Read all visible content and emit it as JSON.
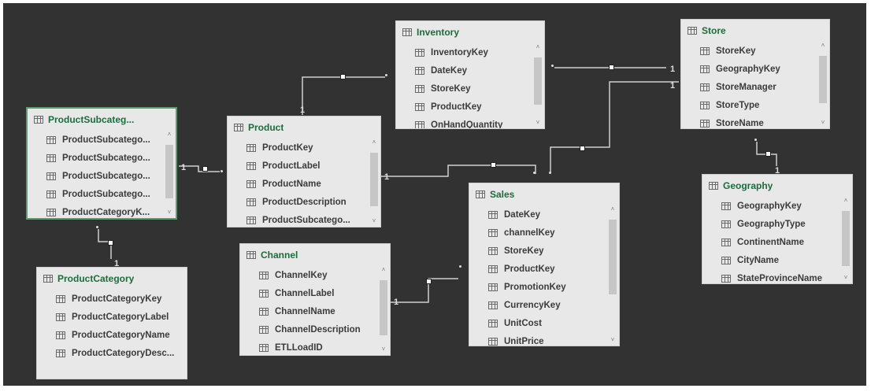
{
  "model": {
    "colors": {
      "canvas": "#323232",
      "table_bg": "#e8e8e8",
      "title": "#1d6c3c",
      "selected_border": "#5f9a72",
      "line": "#cfcfcf"
    },
    "icons": {
      "table": "table-grid-icon",
      "column": "column-icon",
      "scroll_up": "scroll-up-icon",
      "scroll_down": "scroll-down-icon"
    },
    "tables": [
      {
        "title": "ProductSubcateg...",
        "selected": true,
        "scroll": 0.0,
        "columns": [
          "ProductSubcatego...",
          "ProductSubcatego...",
          "ProductSubcatego...",
          "ProductSubcatego...",
          "ProductCategoryK..."
        ]
      },
      {
        "title": "ProductCategory",
        "selected": false,
        "columns": [
          "ProductCategoryKey",
          "ProductCategoryLabel",
          "ProductCategoryName",
          "ProductCategoryDesc..."
        ]
      },
      {
        "title": "Product",
        "selected": false,
        "scroll": 0.0,
        "columns": [
          "ProductKey",
          "ProductLabel",
          "ProductName",
          "ProductDescription",
          "ProductSubcatego..."
        ]
      },
      {
        "title": "Inventory",
        "selected": false,
        "scroll": 0.0,
        "columns": [
          "InventoryKey",
          "DateKey",
          "StoreKey",
          "ProductKey",
          "OnHandQuantity"
        ]
      },
      {
        "title": "Channel",
        "selected": false,
        "scroll": 0.0,
        "columns": [
          "ChannelKey",
          "ChannelLabel",
          "ChannelName",
          "ChannelDescription",
          "ETLLoadID"
        ]
      },
      {
        "title": "Sales",
        "selected": false,
        "scroll": 0.0,
        "columns": [
          "DateKey",
          "channelKey",
          "StoreKey",
          "ProductKey",
          "PromotionKey",
          "CurrencyKey",
          "UnitCost",
          "UnitPrice"
        ]
      },
      {
        "title": "Store",
        "selected": false,
        "scroll": 0.0,
        "columns": [
          "StoreKey",
          "GeographyKey",
          "StoreManager",
          "StoreType",
          "StoreName"
        ]
      },
      {
        "title": "Geography",
        "selected": false,
        "scroll": 0.0,
        "columns": [
          "GeographyKey",
          "GeographyType",
          "ContinentName",
          "CityName",
          "StateProvinceName"
        ]
      }
    ],
    "relationships": [
      {
        "from": "ProductSubcategory",
        "to": "Product",
        "one": "1",
        "many": "*"
      },
      {
        "from": "ProductCategory",
        "to": "ProductSubcategory",
        "one": "1",
        "many": "*"
      },
      {
        "from": "Product",
        "to": "Inventory",
        "one": "1",
        "many": "*"
      },
      {
        "from": "Store",
        "to": "Inventory",
        "one": "1",
        "many": "*"
      },
      {
        "from": "Product",
        "to": "Sales",
        "one": "1",
        "many": "*"
      },
      {
        "from": "Store",
        "to": "Sales",
        "one": "1",
        "many": "*"
      },
      {
        "from": "Channel",
        "to": "Sales",
        "one": "1",
        "many": "*"
      },
      {
        "from": "Geography",
        "to": "Store",
        "one": "1",
        "many": "*"
      }
    ]
  }
}
